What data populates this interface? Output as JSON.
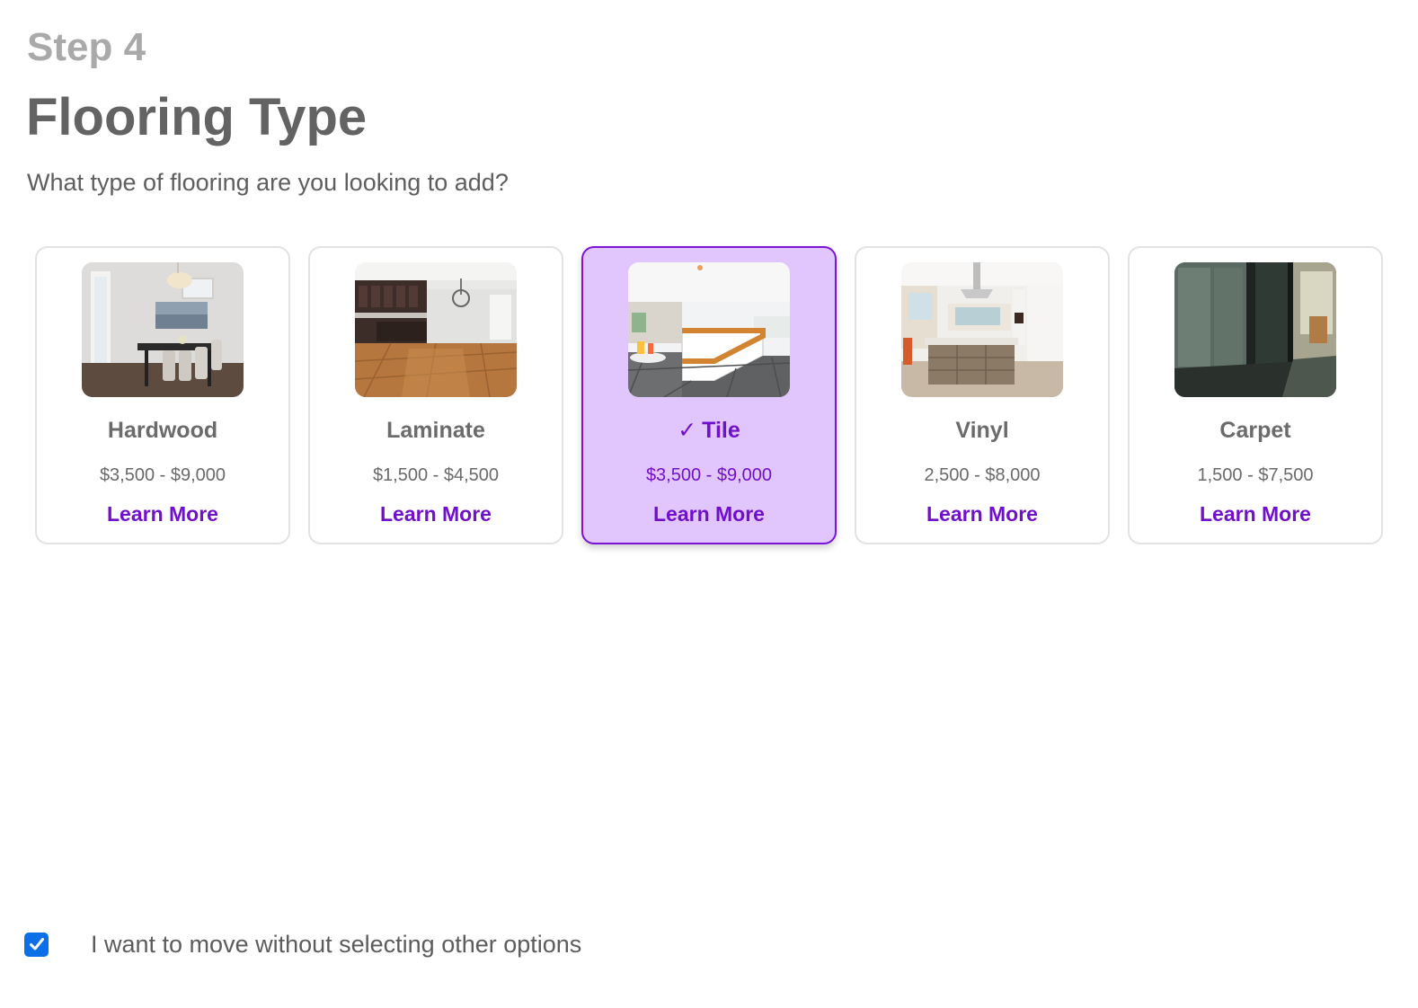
{
  "step": {
    "label": "Step 4"
  },
  "header": {
    "title": "Flooring Type",
    "subtitle": "What type of flooring are you looking to add?"
  },
  "options": [
    {
      "name": "Hardwood",
      "price": "$3,500 - $9,000",
      "link": "Learn More",
      "selected": false,
      "image": "dining-room-photo"
    },
    {
      "name": "Laminate",
      "price": "$1,500 - $4,500",
      "link": "Learn More",
      "selected": false,
      "image": "open-kitchen-photo"
    },
    {
      "name": "Tile",
      "price": "$3,500 - $9,000",
      "link": "Learn More",
      "selected": true,
      "check": "✓",
      "image": "tiled-kitchen-photo"
    },
    {
      "name": "Vinyl",
      "price": "2,500 - $8,000",
      "link": "Learn More",
      "selected": false,
      "image": "kitchen-island-photo"
    },
    {
      "name": "Carpet",
      "price": "1,500 - $7,500",
      "link": "Learn More",
      "selected": false,
      "image": "office-glass-photo"
    }
  ],
  "skip": {
    "label": "I want to move without selecting other options",
    "checked": true
  },
  "colors": {
    "accent": "#7110cc",
    "selected_bg": "#e1c6fd",
    "checkbox": "#0b6fe8"
  }
}
